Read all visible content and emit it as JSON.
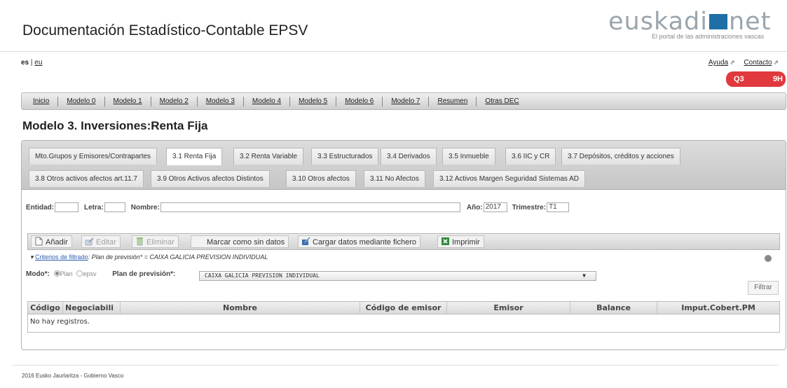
{
  "header": {
    "title": "Documentación Estadístico-Contable EPSV",
    "logo_text_1": "euskadi",
    "logo_text_2": "net",
    "logo_sub": "El portal de las administraciones vascas"
  },
  "lang": {
    "current": "es",
    "sep": "|",
    "other": "eu"
  },
  "toplinks": {
    "help": "Ayuda",
    "contact": "Contacto"
  },
  "badge": {
    "left": "Q3",
    "right": "9H",
    "color": "#e0393e"
  },
  "nav": {
    "items": [
      "Inicio",
      "Modelo 0",
      "Modelo 1",
      "Modelo 2",
      "Modelo 3",
      "Modelo 4",
      "Modelo 5",
      "Modelo 6",
      "Modelo 7",
      "Resumen",
      "Otras DEC"
    ]
  },
  "section_title": "Modelo 3. Inversiones:Renta Fija",
  "tabs": {
    "row1": [
      "Mto.Grupos y Emisores/Contrapartes",
      "3.1 Renta Fija",
      "3.2 Renta Variable",
      "3.3 Estructurados",
      "3.4 Derivados",
      "3.5 Inmueble",
      "3.6 IIC y CR",
      "3.7 Depósitos, créditos y acciones"
    ],
    "row2": [
      "3.8 Otros activos afectos art.11.7",
      "3.9 Otros Activos afectos Distintos",
      "3.10 Otros afectos",
      "3.11 No Afectos",
      "3.12 Activos Margen Seguridad Sistemas AD"
    ],
    "active": "3.1 Renta Fija"
  },
  "filters": {
    "entidad_label": "Entidad:",
    "entidad_value": "",
    "letra_label": "Letra:",
    "letra_value": "",
    "nombre_label": "Nombre:",
    "nombre_value": "",
    "anio_label": "Año:",
    "anio_value": "2017",
    "trimestre_label": "Trimestre:",
    "trimestre_value": "T1"
  },
  "toolbar": {
    "add": "Añadir",
    "edit": "Editar",
    "delete": "Eliminar",
    "mark": "Marcar como sin datos",
    "load": "Cargar datos mediante fichero",
    "print": "Imprimir"
  },
  "criteria": {
    "link": "Criterios de filtrado",
    "text": ": Plan de previsión* = CAIXA GALICIA PREVISION INDIVIDUAL"
  },
  "modo": {
    "label": "Modo*:",
    "opt_plan": "Plan",
    "opt_epsv": "epsv",
    "plan_label": "Plan de previsión*:",
    "plan_value": "CAIXA GALICIA PREVISION INDIVIDUAL",
    "filter_button": "Filtrar"
  },
  "grid": {
    "columns": [
      "Código",
      "Negociabili",
      "Nombre",
      "Código de emisor",
      "Emisor",
      "Balance",
      "Imput.Cobert.PM"
    ],
    "empty": "No hay registros."
  },
  "footer": "2016 Eusko Jaurlaritza - Gobierno Vasco"
}
